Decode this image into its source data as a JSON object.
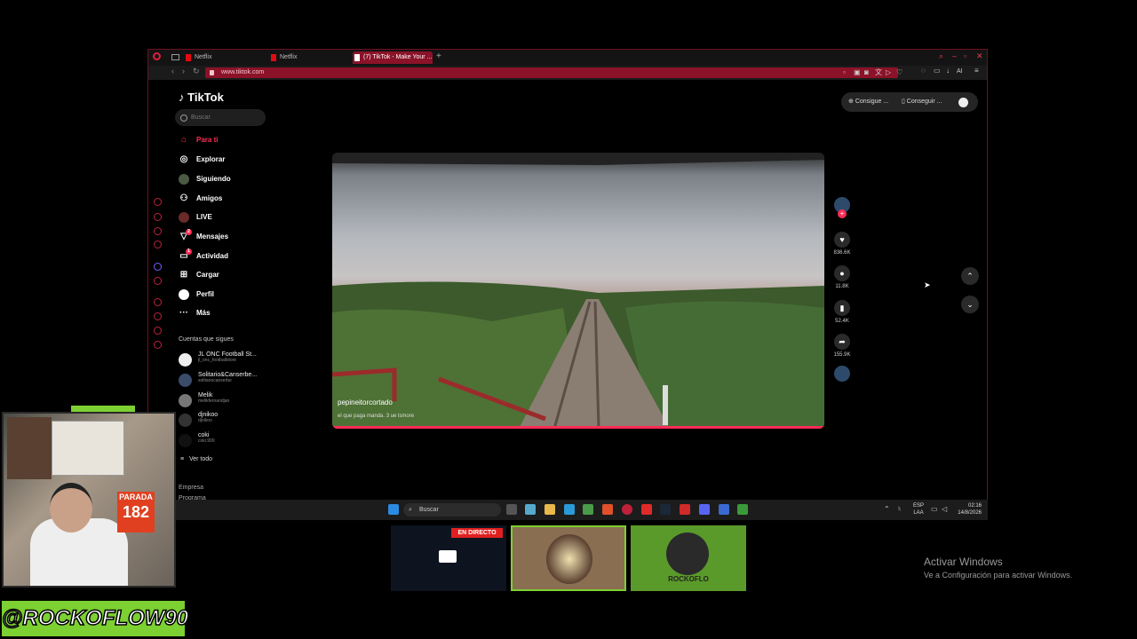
{
  "browser": {
    "tabs": [
      {
        "label": "Netflix"
      },
      {
        "label": "Netflix"
      },
      {
        "label": "(7) TikTok - Make Your ..."
      }
    ],
    "url": "www.tiktok.com",
    "toolbar_ai": "AI"
  },
  "tiktok": {
    "logo": "TikTok",
    "search_placeholder": "Buscar",
    "nav": [
      {
        "label": "Para ti",
        "icon": "home-icon",
        "selected": true
      },
      {
        "label": "Explorar",
        "icon": "compass-icon"
      },
      {
        "label": "Siguiendo",
        "icon": "following-icon"
      },
      {
        "label": "Amigos",
        "icon": "friends-icon"
      },
      {
        "label": "LIVE",
        "icon": "live-icon"
      },
      {
        "label": "Mensajes",
        "icon": "send-icon",
        "badge": "2"
      },
      {
        "label": "Actividad",
        "icon": "inbox-icon",
        "badge": "1"
      },
      {
        "label": "Cargar",
        "icon": "upload-icon"
      },
      {
        "label": "Perfil",
        "icon": "profile-icon"
      },
      {
        "label": "Más",
        "icon": "more-icon"
      }
    ],
    "following_header": "Cuentas que sigues",
    "accounts": [
      {
        "name": "JL ONC Football St...",
        "handle": "jl_onc_footballstore"
      },
      {
        "name": "Solitario&Canserbe...",
        "handle": "solitariocanserbe"
      },
      {
        "name": "Melik",
        "handle": "melikfernandjan"
      },
      {
        "name": "djnikoo",
        "handle": "djnikoo"
      },
      {
        "name": "coki",
        "handle": "coki.999"
      }
    ],
    "see_all": "Ver todo",
    "footer": [
      "Empresa",
      "Programa"
    ],
    "promo": {
      "item1": "Consigue ...",
      "item2": "Conseguir ..."
    },
    "video": {
      "username": "pepineitorcortado",
      "caption": "el que paga manda. 3 ue lsmore"
    },
    "actions": [
      {
        "icon": "heart-icon",
        "count": "836.6K"
      },
      {
        "icon": "comment-icon",
        "count": "11.8K"
      },
      {
        "icon": "bookmark-icon",
        "count": "52.4K"
      },
      {
        "icon": "share-icon",
        "count": "155.9K"
      }
    ]
  },
  "taskbar": {
    "search": "Buscar",
    "lang": "ESP",
    "lang2": "LAA",
    "time": "02:16",
    "date": "14/8/2026"
  },
  "overlay": {
    "handle": "@ROCKOFLOW90",
    "live_badge": "EN DIRECTO",
    "thumb_text": "ROCKOFLO",
    "webcam_sign": "PARADA",
    "webcam_sign_num": "182",
    "activate_title": "Activar Windows",
    "activate_sub": "Ve a Configuración para activar Windows."
  },
  "colors": {
    "accent": "#fe2c55",
    "opera": "#8b1228"
  }
}
